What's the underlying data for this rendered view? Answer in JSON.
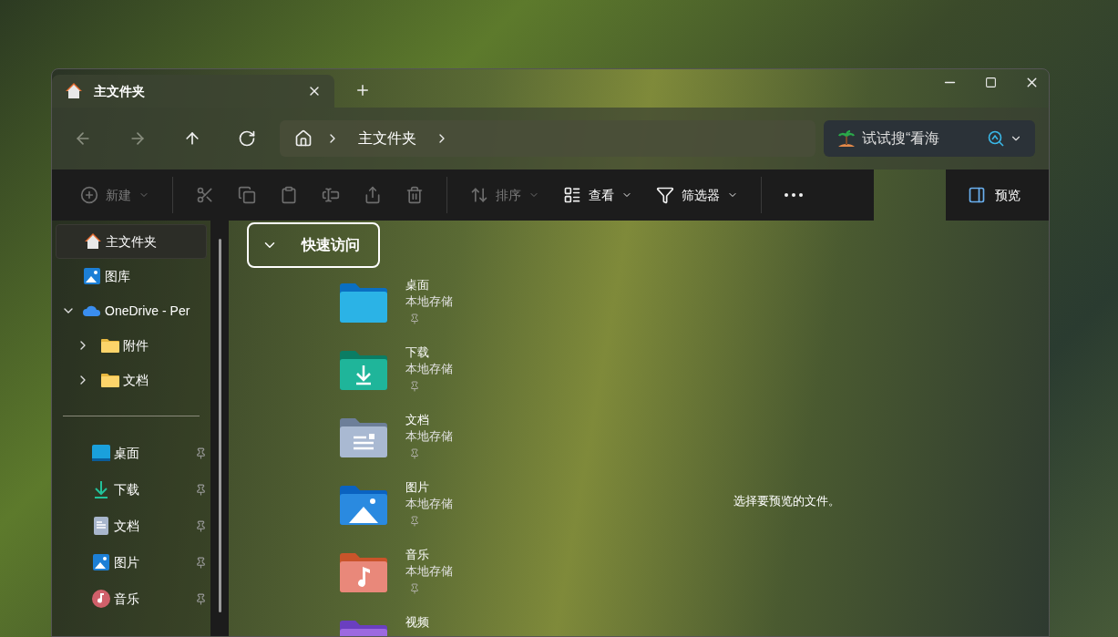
{
  "tabs": [
    {
      "label": "主文件夹",
      "selected": true
    }
  ],
  "nav": [
    {
      "kind": "back",
      "disabled": true
    },
    {
      "kind": "forward",
      "disabled": true
    },
    {
      "kind": "up",
      "disabled": false
    },
    {
      "kind": "refresh",
      "disabled": false
    }
  ],
  "address": {
    "crumbs": [
      "主文件夹"
    ]
  },
  "search": {
    "placeholder": "试试搜“看海"
  },
  "toolbar": [
    {
      "kind": "new",
      "label": "新建",
      "disabled": true
    },
    {
      "kind": "divider"
    },
    {
      "kind": "cut",
      "disabled": true
    },
    {
      "kind": "copy",
      "disabled": true
    },
    {
      "kind": "paste",
      "disabled": true
    },
    {
      "kind": "rename",
      "disabled": true
    },
    {
      "kind": "share",
      "disabled": true
    },
    {
      "kind": "delete",
      "disabled": true
    },
    {
      "kind": "divider"
    },
    {
      "kind": "sort",
      "label": "排序",
      "disabled": true
    },
    {
      "kind": "view",
      "label": "查看",
      "disabled": false
    },
    {
      "kind": "filter",
      "label": "筛选器",
      "disabled": false
    },
    {
      "kind": "divider"
    },
    {
      "kind": "more",
      "disabled": false
    }
  ],
  "preview_button": {
    "label": "预览"
  },
  "sidebar": {
    "items": [
      {
        "label": "主文件夹",
        "kind": "home",
        "selected": true
      },
      {
        "label": "图库",
        "kind": "gallery",
        "selected": false
      },
      {
        "label": "OneDrive - Per",
        "kind": "cloud",
        "selected": false,
        "expanded": true,
        "children": [
          {
            "label": "附件",
            "kind": "folder",
            "selected": false,
            "expanded": false
          },
          {
            "label": "文档",
            "kind": "folder",
            "selected": false,
            "expanded": false
          }
        ]
      }
    ],
    "pinned": [
      {
        "label": "桌面",
        "kind": "desktop",
        "pinned": true
      },
      {
        "label": "下载",
        "kind": "download",
        "pinned": true
      },
      {
        "label": "文档",
        "kind": "document",
        "pinned": true
      },
      {
        "label": "图片",
        "kind": "picture",
        "pinned": true
      },
      {
        "label": "音乐",
        "kind": "music",
        "pinned": true
      }
    ]
  },
  "quick_access": {
    "title": "快速访问",
    "expanded": true,
    "items": [
      {
        "name": "桌面",
        "location": "本地存储",
        "kind": "desktop",
        "pinned": true
      },
      {
        "name": "下载",
        "location": "本地存储",
        "kind": "download",
        "pinned": true
      },
      {
        "name": "文档",
        "location": "本地存储",
        "kind": "document",
        "pinned": true
      },
      {
        "name": "图片",
        "location": "本地存储",
        "kind": "picture",
        "pinned": true
      },
      {
        "name": "音乐",
        "location": "本地存储",
        "kind": "music",
        "pinned": true
      },
      {
        "name": "视频",
        "kind": "video",
        "pinned": false
      }
    ]
  },
  "preview_pane": {
    "message": "选择要预览的文件。"
  }
}
